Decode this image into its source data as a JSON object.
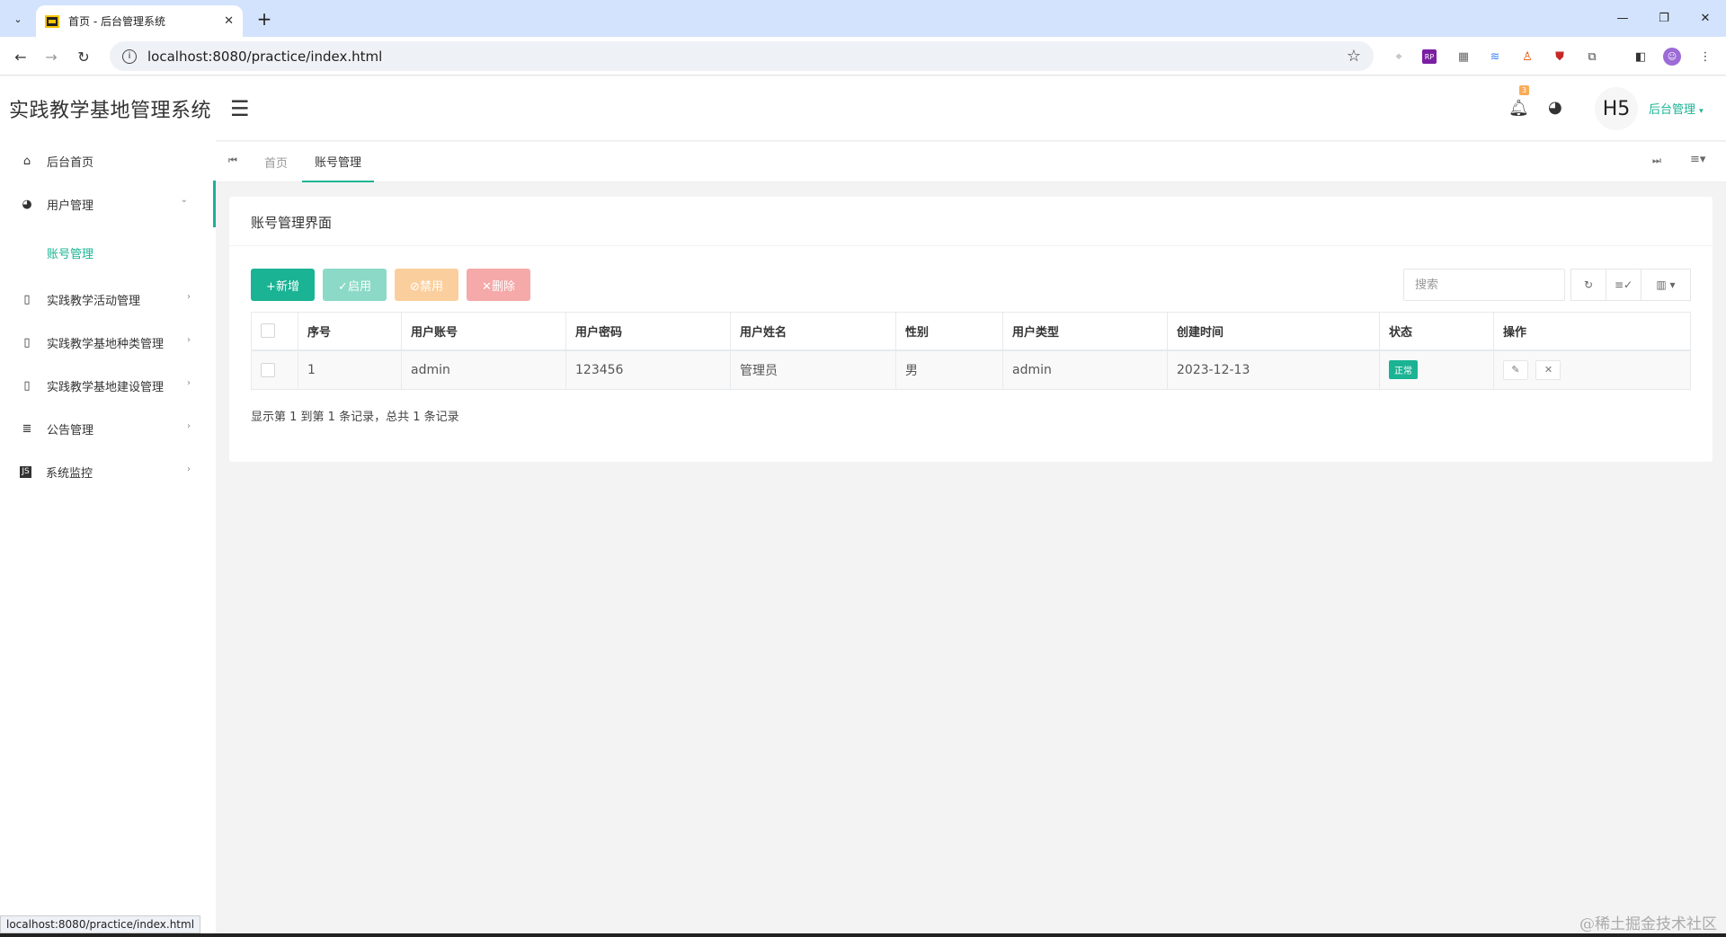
{
  "browser": {
    "tab_title": "首页 - 后台管理系统",
    "url": "localhost:8080/practice/index.html",
    "status_url": "localhost:8080/practice/index.html"
  },
  "app": {
    "brand": "实践教学基地管理系统",
    "header": {
      "notification_count": "3",
      "avatar_text": "H5",
      "user_menu": "后台管理"
    },
    "sidebar": {
      "items": [
        {
          "label": "后台首页",
          "icon": "home-icon"
        },
        {
          "label": "用户管理",
          "icon": "palette-icon",
          "expanded": true
        },
        {
          "label": "实践教学活动管理",
          "icon": "file-icon"
        },
        {
          "label": "实践教学基地种类管理",
          "icon": "file-icon"
        },
        {
          "label": "实践教学基地建设管理",
          "icon": "file-icon"
        },
        {
          "label": "公告管理",
          "icon": "list-icon"
        },
        {
          "label": "系统监控",
          "icon": "js-icon"
        }
      ],
      "subitem": "账号管理"
    },
    "page_tabs": [
      "首页",
      "账号管理"
    ],
    "panel": {
      "title": "账号管理界面",
      "buttons": {
        "add": "+新增",
        "enable": "✓启用",
        "disable": "⊘禁用",
        "delete": "✕删除"
      },
      "search_placeholder": "搜索",
      "columns": [
        "序号",
        "用户账号",
        "用户密码",
        "用户姓名",
        "性别",
        "用户类型",
        "创建时间",
        "状态",
        "操作"
      ],
      "rows": [
        {
          "index": "1",
          "account": "admin",
          "password": "123456",
          "name": "管理员",
          "gender": "男",
          "type": "admin",
          "created": "2023-12-13",
          "status": "正常"
        }
      ],
      "pager_text": "显示第 1 到第 1 条记录，总共 1 条记录"
    }
  },
  "watermark": "@稀土掘金技术社区",
  "colors": {
    "accent": "#1ab394",
    "warning": "#f8ac59",
    "danger": "#ed5565"
  }
}
